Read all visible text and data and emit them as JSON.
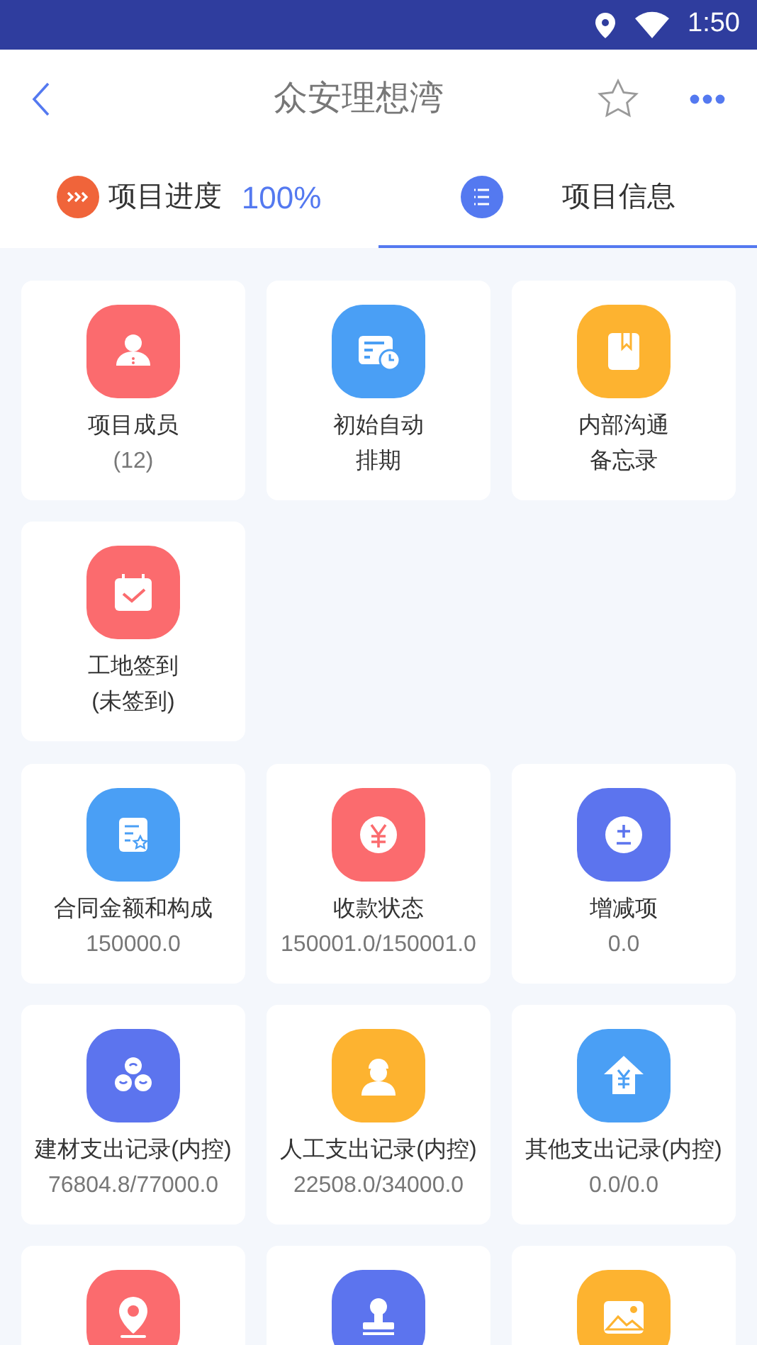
{
  "status_bar": {
    "time": "1:50"
  },
  "header": {
    "title": "众安理想湾"
  },
  "tabs": [
    {
      "kind": "progress",
      "label": "项目进度",
      "value": "100%",
      "selected": false
    },
    {
      "kind": "info",
      "label": "项目信息",
      "selected": true
    }
  ],
  "groups": [
    {
      "tiles": [
        {
          "kind": "person",
          "color": "#fb6b6e",
          "lines": [
            "项目成员"
          ],
          "detail": "(12)"
        },
        {
          "kind": "schedule",
          "color": "#4a9ff5",
          "lines": [
            "初始自动",
            "排期"
          ]
        },
        {
          "kind": "bookmark",
          "color": "#fdb330",
          "lines": [
            "内部沟通",
            "备忘录"
          ]
        },
        {
          "kind": "calendar",
          "color": "#fb6b6e",
          "lines": [
            "工地签到",
            "(未签到)"
          ]
        }
      ]
    },
    {
      "tiles": [
        {
          "kind": "contract",
          "color": "#4a9ff5",
          "lines": [
            "合同金额和构成"
          ],
          "detail": "150000.0"
        },
        {
          "kind": "yen",
          "color": "#fb6b6e",
          "lines": [
            "收款状态"
          ],
          "detail": "150001.0/150001.0"
        },
        {
          "kind": "plusminus",
          "color": "#5c74ee",
          "lines": [
            "增减项"
          ],
          "detail": "0.0"
        },
        {
          "kind": "coins",
          "color": "#5c74ee",
          "lines": [
            "建材支出记录(内控)"
          ],
          "detail": "76804.8/77000.0"
        },
        {
          "kind": "worker",
          "color": "#fdb330",
          "lines": [
            "人工支出记录(内控)"
          ],
          "detail": "22508.0/34000.0"
        },
        {
          "kind": "house",
          "color": "#4a9ff5",
          "lines": [
            "其他支出记录(内控)"
          ],
          "detail": "0.0/0.0"
        },
        {
          "kind": "pin",
          "color": "#fb6b6e"
        },
        {
          "kind": "stamp",
          "color": "#5c74ee"
        },
        {
          "kind": "image",
          "color": "#fdb330"
        }
      ]
    }
  ]
}
